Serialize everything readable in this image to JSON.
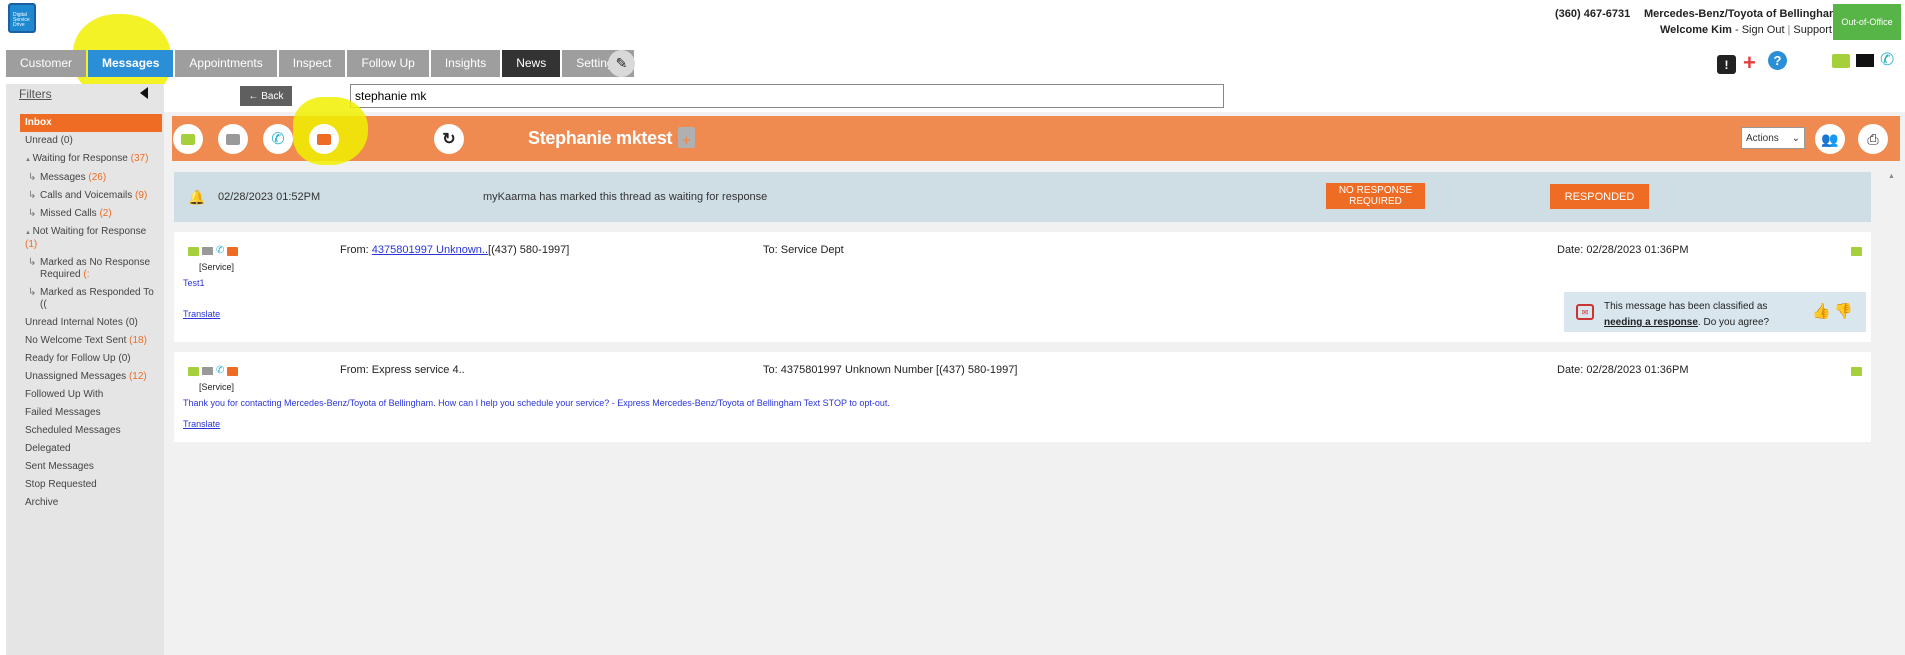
{
  "header": {
    "logo_text": "Digital Service Drive",
    "phone": "(360) 467-6731",
    "dealer_name": "Mercedes-Benz/Toyota of Bellingham",
    "welcome_user": "Welcome Kim",
    "sign_out": "Sign Out",
    "support": "Support",
    "out_of_office": "Out-of-Office"
  },
  "tabs": [
    {
      "label": "Customer"
    },
    {
      "label": "Messages"
    },
    {
      "label": "Appointments"
    },
    {
      "label": "Inspect"
    },
    {
      "label": "Follow Up"
    },
    {
      "label": "Insights"
    },
    {
      "label": "News"
    },
    {
      "label": "Settings"
    }
  ],
  "sidebar": {
    "title": "Filters",
    "items": [
      {
        "label": "Inbox",
        "count": ""
      },
      {
        "label": "Unread",
        "count": "(0)"
      },
      {
        "label": "Waiting for Response",
        "count": "(37)"
      },
      {
        "label": "Messages",
        "count": "(26)"
      },
      {
        "label": "Calls and Voicemails",
        "count": "(9)"
      },
      {
        "label": "Missed Calls",
        "count": "(2)"
      },
      {
        "label": "Not Waiting for Response",
        "count": "(1)"
      },
      {
        "label": "Marked as No Response Required",
        "count": "(:"
      },
      {
        "label": "Marked as Responded To",
        "count": "(("
      },
      {
        "label": "Unread Internal Notes",
        "count": "(0)"
      },
      {
        "label": "No Welcome Text Sent",
        "count": "(18)"
      },
      {
        "label": "Ready for Follow Up",
        "count": "(0)"
      },
      {
        "label": "Unassigned Messages",
        "count": "(12)"
      },
      {
        "label": "Followed Up With",
        "count": ""
      },
      {
        "label": "Failed Messages",
        "count": ""
      },
      {
        "label": "Scheduled Messages",
        "count": ""
      },
      {
        "label": "Delegated",
        "count": ""
      },
      {
        "label": "Sent Messages",
        "count": ""
      },
      {
        "label": "Stop Requested",
        "count": ""
      },
      {
        "label": "Archive",
        "count": ""
      }
    ]
  },
  "toolbar": {
    "back_label": "← Back",
    "search_value": "stephanie mk",
    "thread_title": "Stephanie mktest",
    "actions_label": "Actions"
  },
  "notice": {
    "date": "02/28/2023 01:52PM",
    "text": "myKaarma has marked this thread as waiting for response",
    "no_response_label": "NO RESPONSE REQUIRED",
    "responded_label": "RESPONDED"
  },
  "messages": [
    {
      "tag": "[Service]",
      "from_prefix": "From:",
      "from_link": "4375801997 Unknown..",
      "from_rest": "[(437) 580-1997]",
      "to": "To: Service Dept",
      "date": "Date: 02/28/2023 01:36PM",
      "body": "Test1",
      "translate": "Translate",
      "classified_text": "This message has been classified as",
      "classified_link": "needing a response",
      "classified_suffix": ". Do you agree?"
    },
    {
      "tag": "[Service]",
      "from_prefix": "From: Express service 4..",
      "to": "To: 4375801997 Unknown Number [(437) 580-1997]",
      "date": "Date: 02/28/2023 01:36PM",
      "body": "Thank you for contacting Mercedes-Benz/Toyota of Bellingham. How can I help you schedule your service? - Express Mercedes-Benz/Toyota of Bellingham Text STOP to opt-out.",
      "translate": "Translate"
    }
  ],
  "colors": {
    "accent_orange": "#ef6c24",
    "bar_orange": "#ef8a50",
    "tab_active_blue": "#2b8fd8",
    "sms_green": "#a6cf3c",
    "highlight_yellow": "#f0f000"
  }
}
